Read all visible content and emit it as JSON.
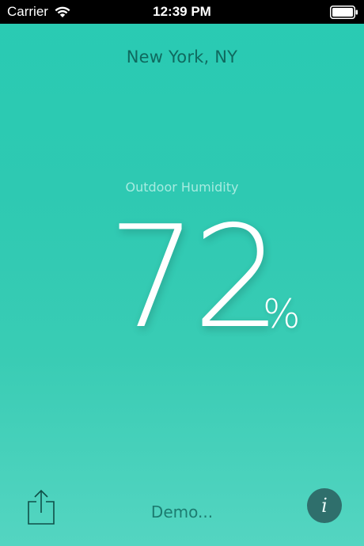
{
  "status_bar": {
    "carrier": "Carrier",
    "time": "12:39 PM",
    "wifi_icon": "wifi-icon",
    "battery_icon": "battery-icon"
  },
  "weather": {
    "city": "New York, NY",
    "metric_label": "Outdoor Humidity",
    "metric_value": "72",
    "metric_unit": "%"
  },
  "toolbar": {
    "share_icon": "share-icon",
    "status_text": "Demo...",
    "info_label": "i"
  },
  "colors": {
    "background_top": "#29cbb3",
    "background_bottom": "#54d5c1",
    "city_text": "#0f6a5f",
    "label_text": "#a6ebe0",
    "info_button": "#2f6f6c"
  }
}
